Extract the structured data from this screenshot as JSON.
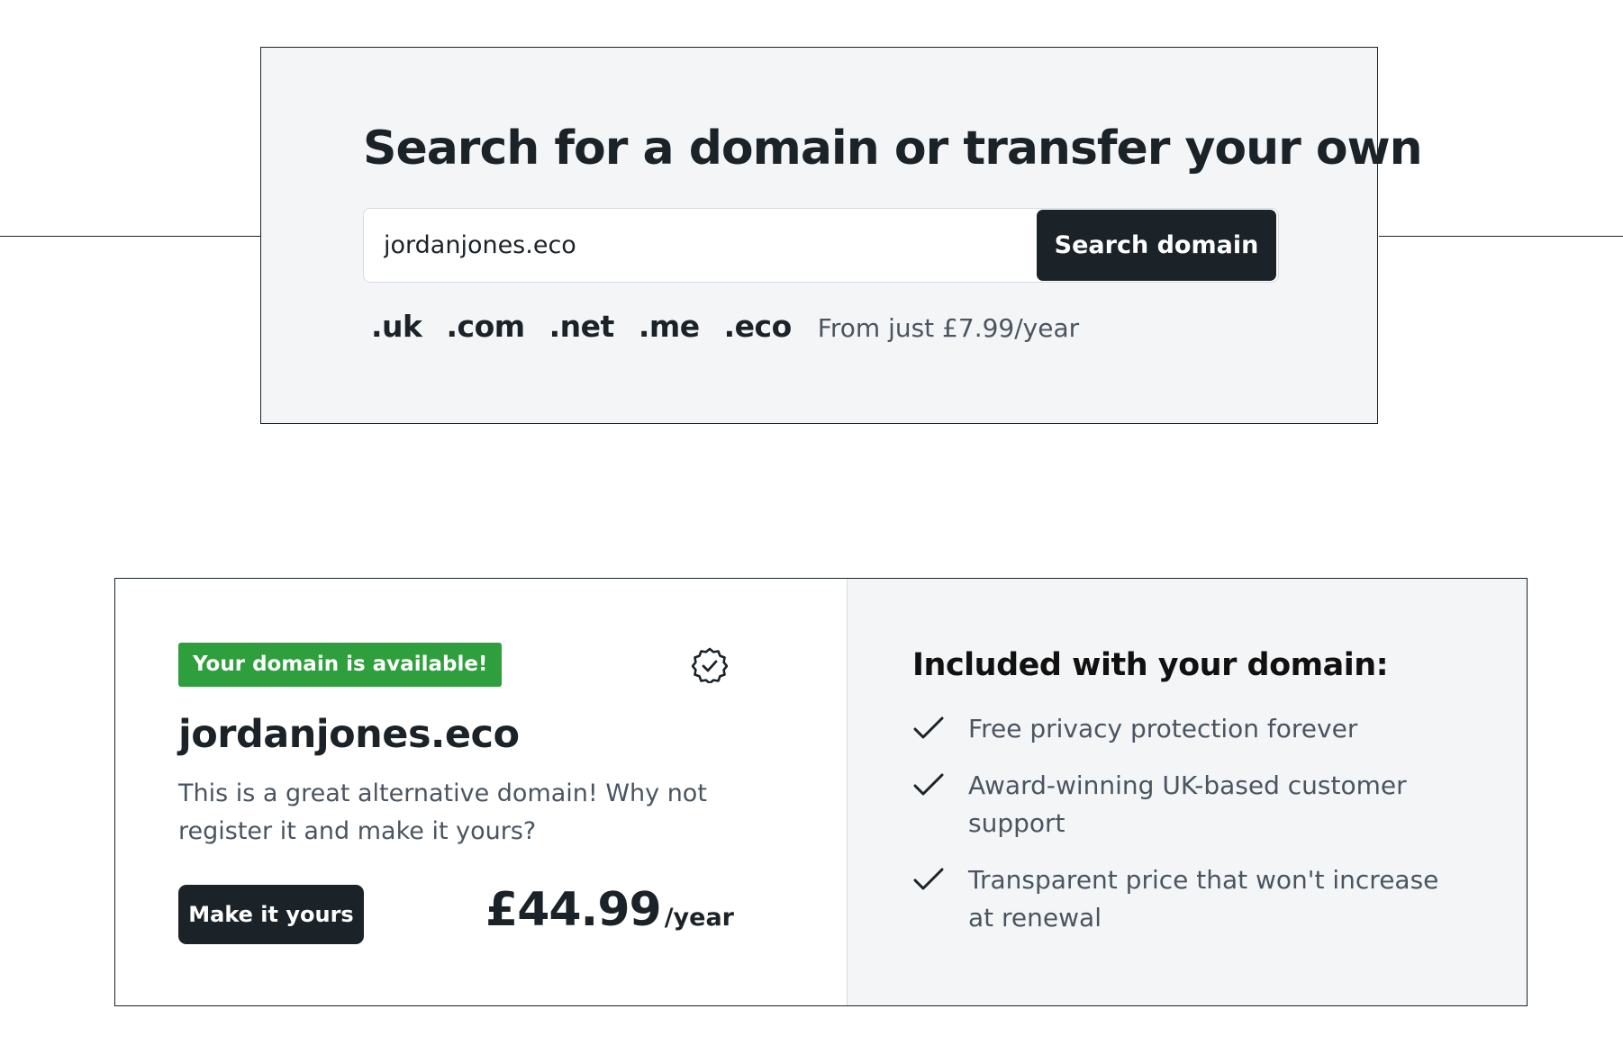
{
  "search": {
    "title": "Search for a domain or transfer your own",
    "input_value": "jordanjones.eco",
    "button_label": "Search domain",
    "tlds": [
      ".uk",
      ".com",
      ".net",
      ".me",
      ".eco"
    ],
    "price_note": "From just £7.99/year"
  },
  "result": {
    "badge": "Your domain is available!",
    "badge_color": "#2f9e3c",
    "badge_icon": "verified-badge-icon",
    "domain": "jordanjones.eco",
    "description": "This is a great alternative domain! Why not register it and make it yours?",
    "cta_label": "Make it yours",
    "price": "£44.99",
    "price_period": "/year"
  },
  "included": {
    "title": "Included with your domain:",
    "items": [
      "Free privacy protection forever",
      "Award-winning UK-based customer support",
      "Transparent price that won't increase at renewal"
    ],
    "item_icon": "check-icon"
  },
  "colors": {
    "primary_dark": "#1b2328",
    "panel_bg": "#f4f5f7",
    "text_muted": "#4a5560"
  }
}
